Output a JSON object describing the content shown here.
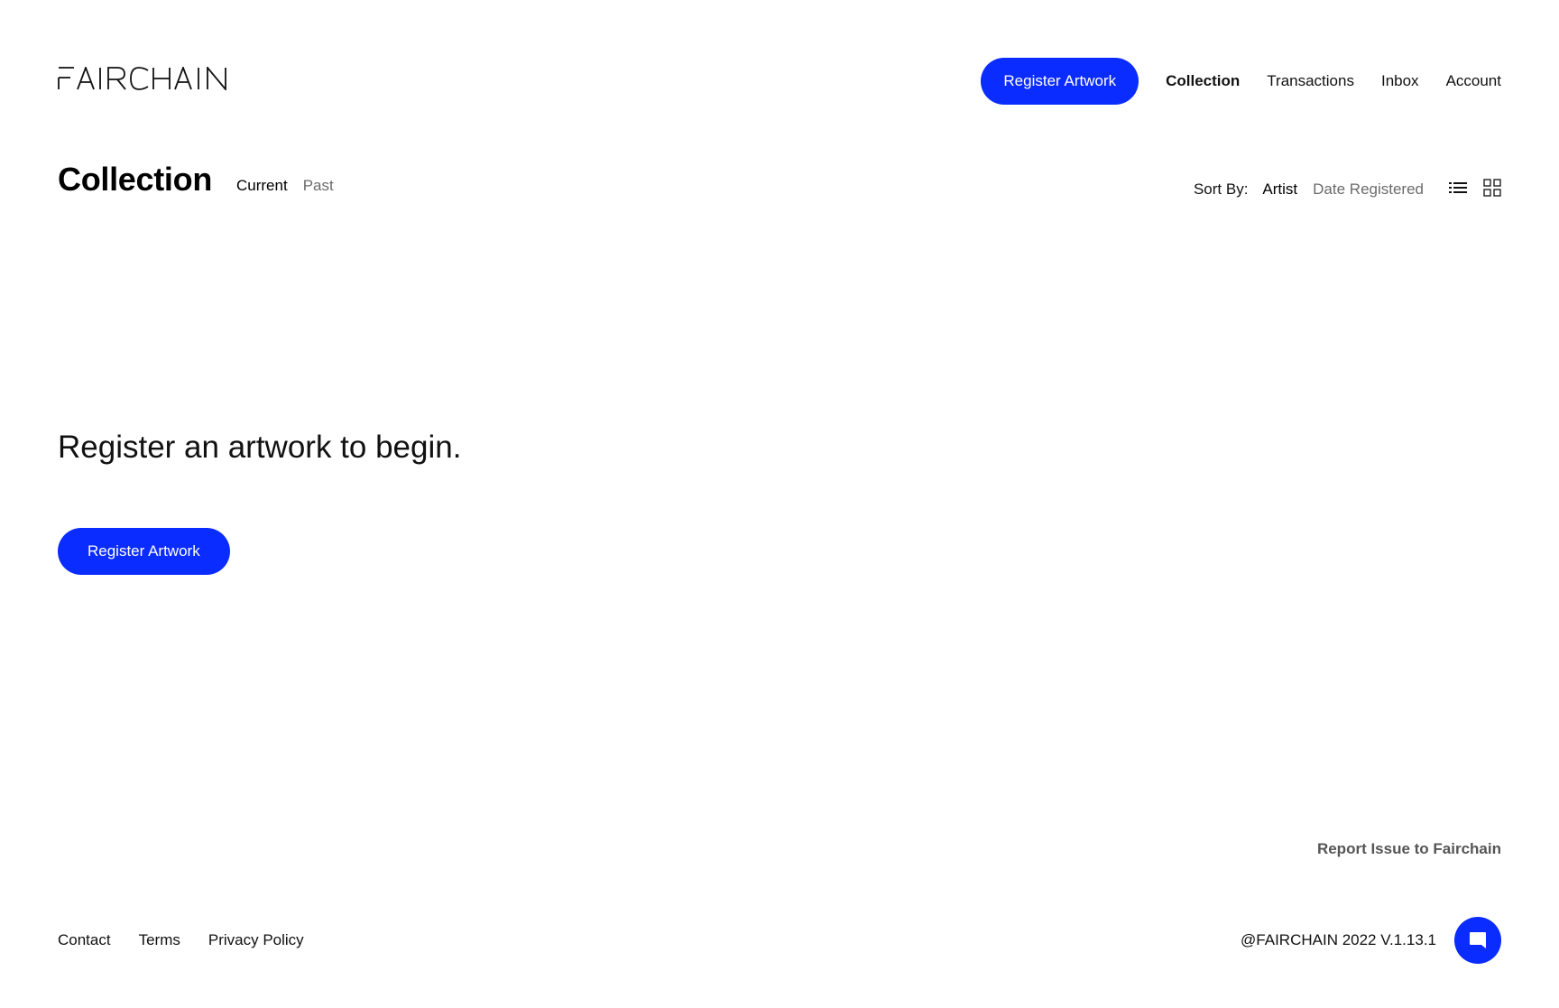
{
  "header": {
    "logo_text": "FAIRCHAIN",
    "register_button": "Register Artwork",
    "nav": [
      {
        "label": "Collection",
        "active": true
      },
      {
        "label": "Transactions",
        "active": false
      },
      {
        "label": "Inbox",
        "active": false
      },
      {
        "label": "Account",
        "active": false
      }
    ]
  },
  "page": {
    "title": "Collection",
    "tabs": [
      {
        "label": "Current",
        "active": true
      },
      {
        "label": "Past",
        "active": false
      }
    ],
    "sort": {
      "label": "Sort By:",
      "options": [
        {
          "label": "Artist",
          "active": true
        },
        {
          "label": "Date Registered",
          "active": false
        }
      ]
    },
    "view_icons": [
      "list-view-icon",
      "grid-view-icon"
    ]
  },
  "empty_state": {
    "message": "Register an artwork to begin.",
    "button": "Register Artwork"
  },
  "footer": {
    "report_link": "Report Issue to Fairchain",
    "links": [
      "Contact",
      "Terms",
      "Privacy Policy"
    ],
    "copyright": "@FAIRCHAIN 2022 V.1.13.1",
    "chat_icon": "chat-icon"
  },
  "colors": {
    "accent": "#0a2cff",
    "text": "#111111",
    "muted": "#6b6b6b"
  }
}
